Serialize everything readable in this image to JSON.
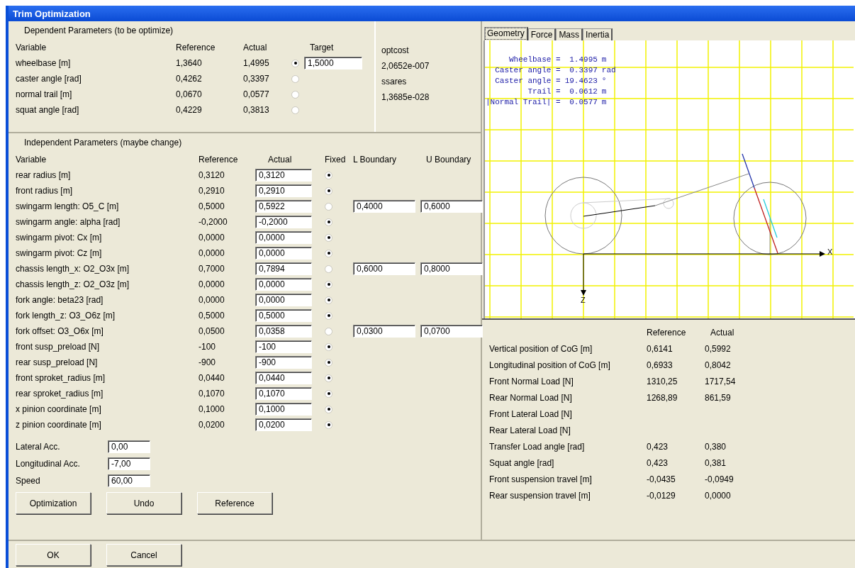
{
  "window": {
    "title": "Trim Optimization"
  },
  "dependent": {
    "title": "Dependent Parameters (to be optimize)",
    "columns": [
      "Variable",
      "Reference",
      "Actual",
      "Target"
    ],
    "rows": [
      {
        "variable": "wheelbase [m]",
        "reference": "1,3640",
        "actual": "1,4995",
        "selected": true,
        "target": "1,5000"
      },
      {
        "variable": "caster angle [rad]",
        "reference": "0,4262",
        "actual": "0,3397",
        "selected": false
      },
      {
        "variable": "normal trail [m]",
        "reference": "0,0670",
        "actual": "0,0577",
        "selected": false
      },
      {
        "variable": "squat angle [rad]",
        "reference": "0,4229",
        "actual": "0,3813",
        "selected": false
      }
    ],
    "side": [
      "optcost",
      "2,0652e-007",
      "ssares",
      "1,3685e-028"
    ]
  },
  "independent": {
    "title": "Independent Parameters (maybe change)",
    "columns": [
      "Variable",
      "Reference",
      "Actual",
      "Fixed",
      "L Boundary",
      "U Boundary"
    ],
    "rows": [
      {
        "variable": "rear radius  [m]",
        "reference": "0,3120",
        "actual": "0,3120",
        "fixed": true
      },
      {
        "variable": "front radius [m]",
        "reference": "0,2910",
        "actual": "0,2910",
        "fixed": true
      },
      {
        "variable": "swingarm length: O5_C [m]",
        "reference": "0,5000",
        "actual": "0,5922",
        "fixed": false,
        "l_boundary": "0,4000",
        "u_boundary": "0,6000"
      },
      {
        "variable": "swingarm angle: alpha [rad]",
        "reference": "-0,2000",
        "actual": "-0,2000",
        "fixed": true
      },
      {
        "variable": "swingarm pivot: Cx [m]",
        "reference": "0,0000",
        "actual": "0,0000",
        "fixed": true
      },
      {
        "variable": "swingarm pivot: Cz [m]",
        "reference": "0,0000",
        "actual": "0,0000",
        "fixed": true
      },
      {
        "variable": "chassis length_x: O2_O3x [m]",
        "reference": "0,7000",
        "actual": "0,7894",
        "fixed": false,
        "l_boundary": "0,6000",
        "u_boundary": "0,8000"
      },
      {
        "variable": "chassis length_z: O2_O3z [m]",
        "reference": "0,0000",
        "actual": "0,0000",
        "fixed": true
      },
      {
        "variable": "fork angle: beta23 [rad]",
        "reference": "0,0000",
        "actual": "0,0000",
        "fixed": true
      },
      {
        "variable": "fork length_z: O3_O6z [m]",
        "reference": "0,5000",
        "actual": "0,5000",
        "fixed": true
      },
      {
        "variable": "fork offset: O3_O6x [m]",
        "reference": "0,0500",
        "actual": "0,0358",
        "fixed": false,
        "l_boundary": "0,0300",
        "u_boundary": "0,0700"
      },
      {
        "variable": "front susp_preload [N]",
        "reference": "-100",
        "actual": "-100",
        "fixed": true
      },
      {
        "variable": "rear susp_preload [N]",
        "reference": "-900",
        "actual": "-900",
        "fixed": true
      },
      {
        "variable": "front sproket_radius [m]",
        "reference": "0,0440",
        "actual": "0,0440",
        "fixed": true
      },
      {
        "variable": "rear sproket_radius [m]",
        "reference": "0,1070",
        "actual": "0,1070",
        "fixed": true
      },
      {
        "variable": "x pinion coordinate [m]",
        "reference": "0,1000",
        "actual": "0,1000",
        "fixed": true
      },
      {
        "variable": "z pinion coordinate [m]",
        "reference": "0,0200",
        "actual": "0,0200",
        "fixed": true
      }
    ]
  },
  "conditions": [
    {
      "label": "Lateral Acc.",
      "value": "0,00"
    },
    {
      "label": "Longitudinal Acc.",
      "value": "-7,00"
    },
    {
      "label": "Speed",
      "value": "60,00"
    }
  ],
  "actions": [
    "Optimization",
    "Undo",
    "Reference"
  ],
  "tabs": [
    {
      "label": "Geometry",
      "selected": true
    },
    {
      "label": "Force",
      "selected": false
    },
    {
      "label": "Mass",
      "selected": false
    },
    {
      "label": "Inertia",
      "selected": false
    }
  ],
  "geometry": {
    "readouts": [
      {
        "label": "Wheelbase =",
        "value": "1.4995",
        "unit": "m"
      },
      {
        "label": "Caster angle =",
        "value": "0.3397",
        "unit": "rad"
      },
      {
        "label": "Caster angle =",
        "value": "19.4623",
        "unit": "°"
      },
      {
        "label": "Trail =",
        "value": "0.0612",
        "unit": "m"
      },
      {
        "label": "|Normal Trail| =",
        "value": "0.0577",
        "unit": "m"
      }
    ],
    "axis_labels": [
      "X",
      "Z"
    ]
  },
  "results": {
    "columns": [
      "Reference",
      "Actual"
    ],
    "rows": [
      {
        "label": "Vertical position of CoG [m]",
        "reference": "0,6141",
        "actual": "0,5992"
      },
      {
        "label": "Longitudinal position of CoG [m]",
        "reference": "0,6933",
        "actual": "0,8042"
      },
      {
        "label": "Front Normal Load [N]",
        "reference": "1310,25",
        "actual": "1717,54"
      },
      {
        "label": "Rear Normal Load [N]",
        "reference": "1268,89",
        "actual": "861,59"
      },
      {
        "label": "Front Lateral Load [N]"
      },
      {
        "label": "Rear Lateral Load [N]"
      },
      {
        "label": "Transfer Load angle [rad]",
        "reference": "0,423",
        "actual": "0,380"
      },
      {
        "label": "Squat angle [rad]",
        "reference": "0,423",
        "actual": "0,381"
      },
      {
        "label": "Front suspension travel [m]",
        "reference": "-0,0435",
        "actual": "-0,0949"
      },
      {
        "label": "Rear suspension travel [m]",
        "reference": "-0,0129",
        "actual": "0,0000"
      }
    ]
  },
  "buttons": [
    "OK",
    "Cancel"
  ]
}
